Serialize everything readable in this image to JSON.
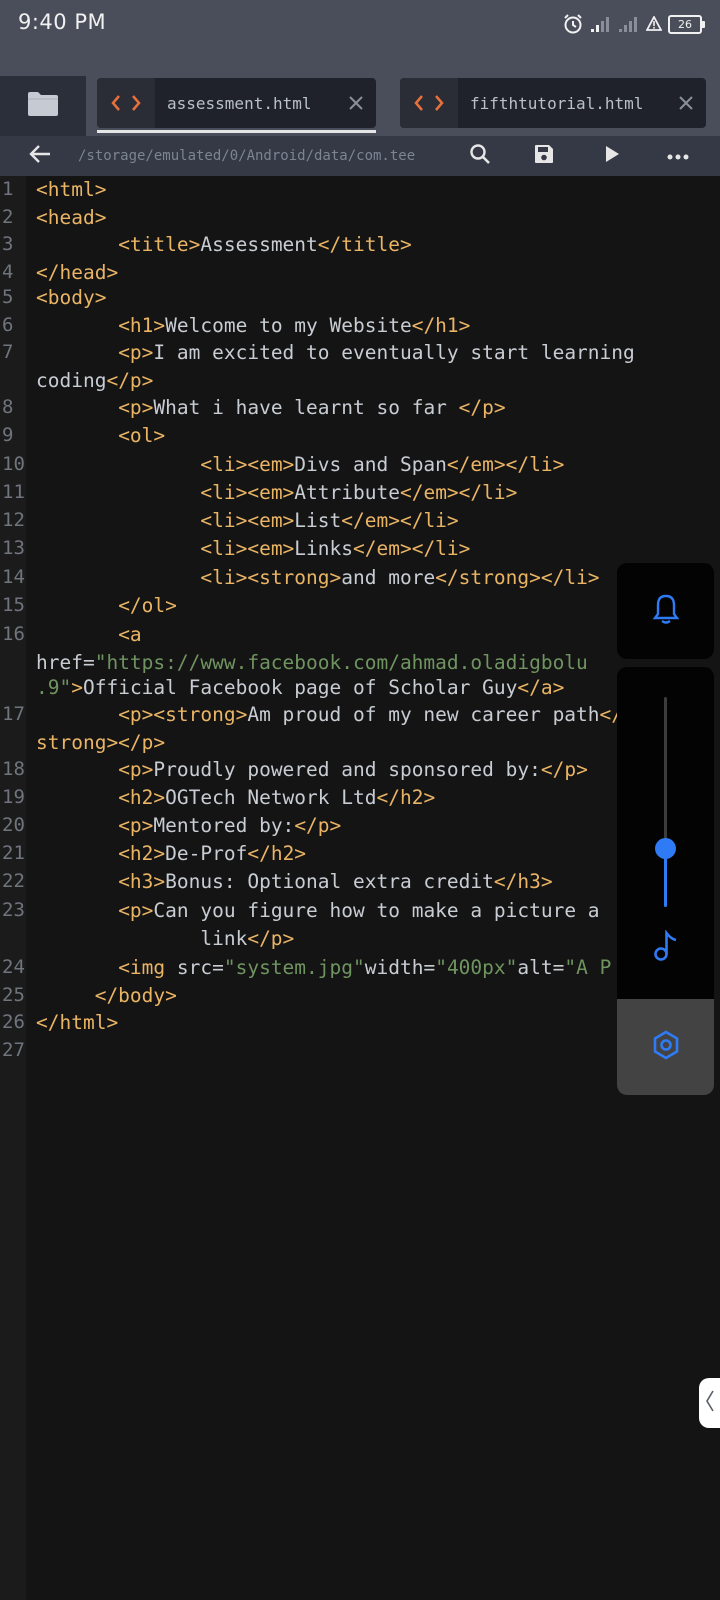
{
  "status_bar": {
    "time": "9:40 PM",
    "battery": "26",
    "icons": [
      "alarm-icon",
      "signal-icon",
      "signal-icon",
      "alert-icon",
      "battery-icon"
    ]
  },
  "tabs": [
    {
      "label": "assessment.html",
      "active": true
    },
    {
      "label": "fifthtutorial.html",
      "active": false
    }
  ],
  "toolbar": {
    "path": "/storage/emulated/0/Android/data/com.tee"
  },
  "editor": {
    "line_numbers": [
      "1",
      "2",
      "3",
      "4",
      "5",
      "6",
      "7",
      "",
      "8",
      "9",
      "10",
      "11",
      "12",
      "13",
      "14",
      "15",
      "16",
      "",
      "",
      "17",
      "",
      "18",
      "19",
      "20",
      "21",
      "22",
      "23",
      "",
      "24",
      "25",
      "26",
      "27"
    ],
    "lines": [
      [
        [
          "tag",
          "<html>"
        ]
      ],
      [
        [
          "tag",
          "<head>"
        ]
      ],
      [
        [
          "txt",
          "       "
        ],
        [
          "tag",
          "<title>"
        ],
        [
          "txt",
          "Assessment"
        ],
        [
          "tag",
          "</title>"
        ]
      ],
      [
        [
          "tag",
          "</head>"
        ]
      ],
      [
        [
          "tag",
          "<body>"
        ]
      ],
      [
        [
          "txt",
          "       "
        ],
        [
          "tag",
          "<h1>"
        ],
        [
          "txt",
          "Welcome to my Website"
        ],
        [
          "tag",
          "</h1>"
        ]
      ],
      [
        [
          "txt",
          "       "
        ],
        [
          "tag",
          "<p>"
        ],
        [
          "txt",
          "I am excited to eventually start learning"
        ]
      ],
      [
        [
          "txt",
          "coding"
        ],
        [
          "tag",
          "</p>"
        ]
      ],
      [
        [
          "txt",
          "       "
        ],
        [
          "tag",
          "<p>"
        ],
        [
          "txt",
          "What i have learnt so far "
        ],
        [
          "tag",
          "</p>"
        ]
      ],
      [
        [
          "txt",
          "       "
        ],
        [
          "tag",
          "<ol>"
        ]
      ],
      [
        [
          "txt",
          "              "
        ],
        [
          "tag",
          "<li><em>"
        ],
        [
          "txt",
          "Divs and Span"
        ],
        [
          "tag",
          "</em></li>"
        ]
      ],
      [
        [
          "txt",
          "              "
        ],
        [
          "tag",
          "<li><em>"
        ],
        [
          "txt",
          "Attribute"
        ],
        [
          "tag",
          "</em></li>"
        ]
      ],
      [
        [
          "txt",
          "              "
        ],
        [
          "tag",
          "<li><em>"
        ],
        [
          "txt",
          "List"
        ],
        [
          "tag",
          "</em></li>"
        ]
      ],
      [
        [
          "txt",
          "              "
        ],
        [
          "tag",
          "<li><em>"
        ],
        [
          "txt",
          "Links"
        ],
        [
          "tag",
          "</em></li>"
        ]
      ],
      [
        [
          "txt",
          "              "
        ],
        [
          "tag",
          "<li><strong>"
        ],
        [
          "txt",
          "and more"
        ],
        [
          "tag",
          "</strong></li>"
        ]
      ],
      [
        [
          "txt",
          "       "
        ],
        [
          "tag",
          "</ol>"
        ]
      ],
      [
        [
          "txt",
          "       "
        ],
        [
          "tag",
          "<a"
        ]
      ],
      [
        [
          "attr",
          "href="
        ],
        [
          "str",
          "\"https://www.facebook.com/ahmad.oladigbolu"
        ]
      ],
      [
        [
          "str",
          ".9\""
        ],
        [
          "tag",
          ">"
        ],
        [
          "txt",
          "Official Facebook page of Scholar Guy"
        ],
        [
          "tag",
          "</a>"
        ]
      ],
      [
        [
          "txt",
          "       "
        ],
        [
          "tag",
          "<p><strong>"
        ],
        [
          "txt",
          "Am proud of my new career path"
        ],
        [
          "tag",
          "</"
        ]
      ],
      [
        [
          "tag",
          "strong></p>"
        ]
      ],
      [
        [
          "txt",
          "       "
        ],
        [
          "tag",
          "<p>"
        ],
        [
          "txt",
          "Proudly powered and sponsored by:"
        ],
        [
          "tag",
          "</p>"
        ]
      ],
      [
        [
          "txt",
          "       "
        ],
        [
          "tag",
          "<h2>"
        ],
        [
          "txt",
          "OGTech Network Ltd"
        ],
        [
          "tag",
          "</h2>"
        ]
      ],
      [
        [
          "txt",
          "       "
        ],
        [
          "tag",
          "<p>"
        ],
        [
          "txt",
          "Mentored by:"
        ],
        [
          "tag",
          "</p>"
        ]
      ],
      [
        [
          "txt",
          "       "
        ],
        [
          "tag",
          "<h2>"
        ],
        [
          "txt",
          "De-Prof"
        ],
        [
          "tag",
          "</h2>"
        ]
      ],
      [
        [
          "txt",
          "       "
        ],
        [
          "tag",
          "<h3>"
        ],
        [
          "txt",
          "Bonus: Optional extra credit"
        ],
        [
          "tag",
          "</h3>"
        ]
      ],
      [
        [
          "txt",
          "       "
        ],
        [
          "tag",
          "<p>"
        ],
        [
          "txt",
          "Can you figure how to make a picture a"
        ]
      ],
      [
        [
          "txt",
          "              link"
        ],
        [
          "tag",
          "</p>"
        ]
      ],
      [
        [
          "txt",
          "       "
        ],
        [
          "tag",
          "<img "
        ],
        [
          "attr",
          "src="
        ],
        [
          "str",
          "\"system.jpg\""
        ],
        [
          "attr",
          "width="
        ],
        [
          "str",
          "\"400px\""
        ],
        [
          "attr",
          "alt="
        ],
        [
          "str",
          "\"A P"
        ]
      ],
      [
        [
          "txt",
          "     "
        ],
        [
          "tag",
          "</body>"
        ]
      ],
      [
        [
          "tag",
          "</html>"
        ]
      ],
      []
    ]
  },
  "volume": {
    "level": 0.28
  },
  "colors": {
    "accent": "#2f7bf6",
    "tag": "#eab465",
    "string": "#6f9460",
    "text": "#c8ccd3",
    "code_icon": "#e8703a"
  }
}
